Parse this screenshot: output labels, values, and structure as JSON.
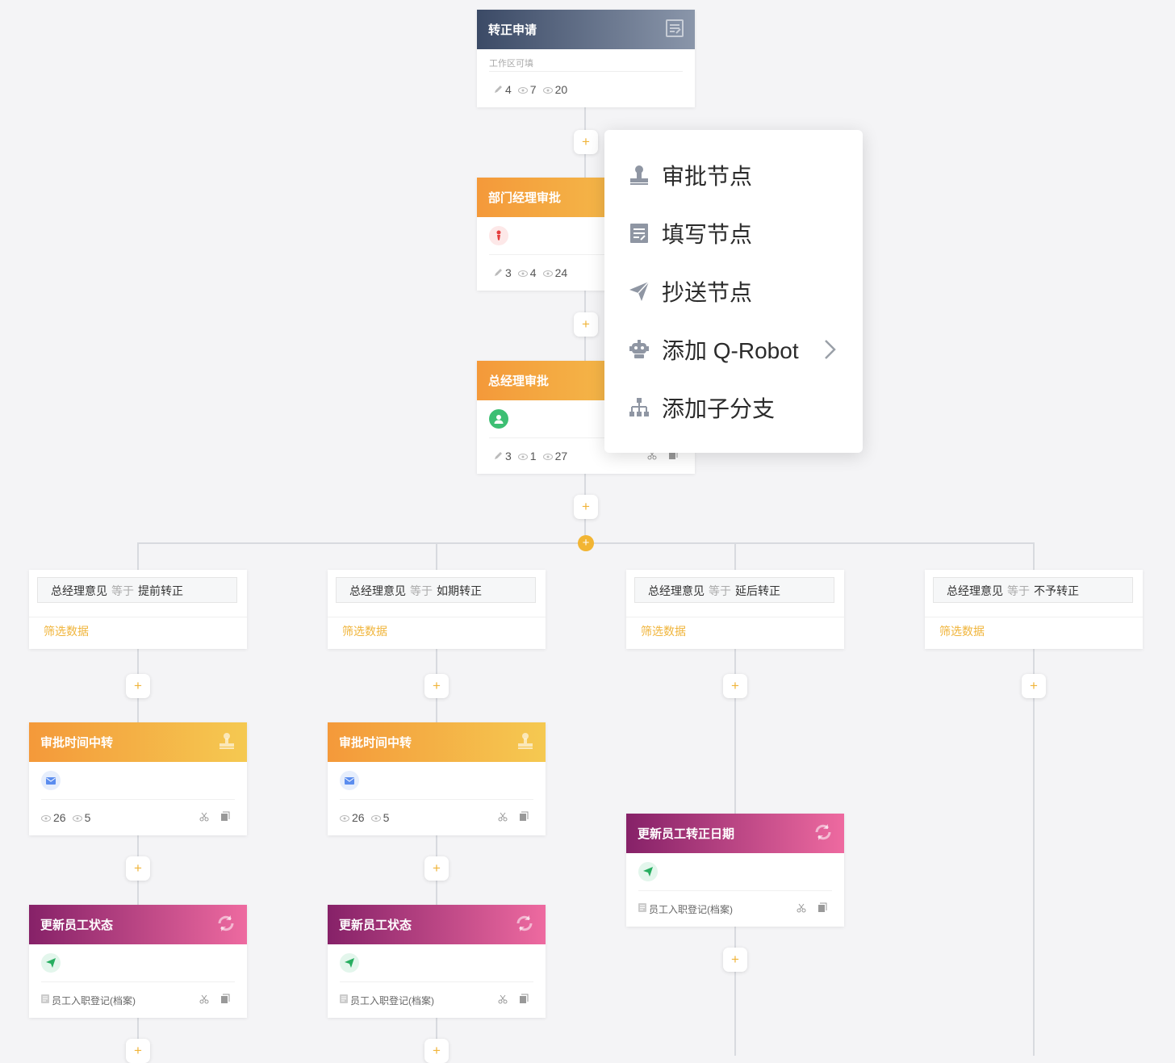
{
  "colors": {
    "accent": "#f0b43a",
    "line": "#d8dadf",
    "fill_header": "#3b4a66",
    "approval_header": "#f4993a",
    "robot_header": "#862168"
  },
  "start_node": {
    "title": "转正申请",
    "subtitle": "工作区可填",
    "stats": {
      "edit": "4",
      "view1": "7",
      "view2": "20"
    }
  },
  "nodes": {
    "dept_approval": {
      "title": "部门经理审批",
      "stats": {
        "edit": "3",
        "view1": "4",
        "view2": "24"
      }
    },
    "gm_approval": {
      "title": "总经理审批",
      "stats": {
        "edit": "3",
        "view1": "1",
        "view2": "27"
      }
    }
  },
  "branches": [
    {
      "field": "总经理意见",
      "op": "等于",
      "value": "提前转正",
      "filter": "筛选数据",
      "approval": {
        "title": "审批时间中转",
        "stats": {
          "view1": "26",
          "view2": "5"
        }
      },
      "update": {
        "title": "更新员工状态",
        "form": "员工入职登记(档案)"
      }
    },
    {
      "field": "总经理意见",
      "op": "等于",
      "value": "如期转正",
      "filter": "筛选数据",
      "approval": {
        "title": "审批时间中转",
        "stats": {
          "view1": "26",
          "view2": "5"
        }
      },
      "update": {
        "title": "更新员工状态",
        "form": "员工入职登记(档案)"
      }
    },
    {
      "field": "总经理意见",
      "op": "等于",
      "value": "延后转正",
      "filter": "筛选数据",
      "update": {
        "title": "更新员工转正日期",
        "form": "员工入职登记(档案)"
      }
    },
    {
      "field": "总经理意见",
      "op": "等于",
      "value": "不予转正",
      "filter": "筛选数据"
    }
  ],
  "plus_symbol": "+",
  "menu": {
    "items": [
      {
        "label": "审批节点",
        "icon": "stamp-icon"
      },
      {
        "label": "填写节点",
        "icon": "form-icon"
      },
      {
        "label": "抄送节点",
        "icon": "send-icon"
      },
      {
        "label": "添加 Q-Robot",
        "icon": "robot-icon",
        "has_submenu": true
      },
      {
        "label": "添加子分支",
        "icon": "branch-icon"
      }
    ]
  }
}
